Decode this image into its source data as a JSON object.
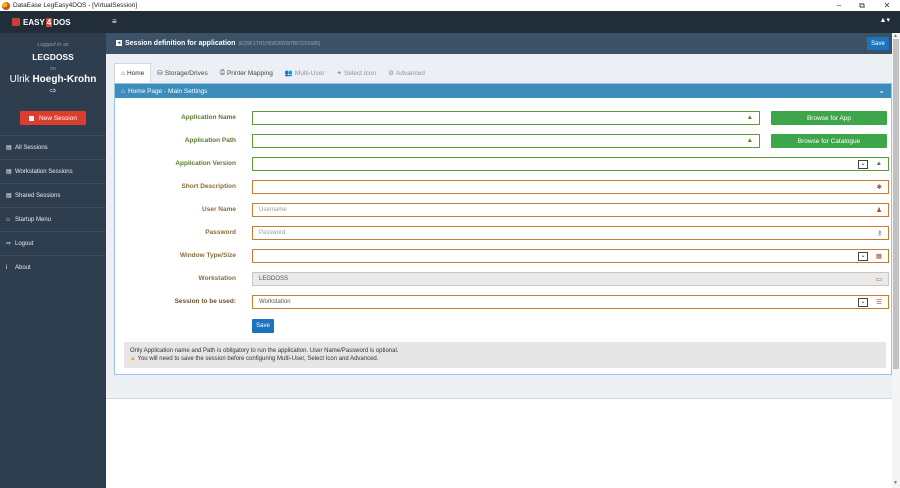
{
  "window": {
    "title": "DataEase LegEasy4DOS - [VirtualSession]",
    "min_glyph": "–",
    "max_glyph": "⧉",
    "close_glyph": "✕"
  },
  "sidebar": {
    "logo_pre": "EASY",
    "logo_four": "4",
    "logo_post": "DOS",
    "logged_in": "Logged in as",
    "workstation": "LEGDOSS",
    "on_label": "on",
    "user_first": "Ulrik ",
    "user_last": "Hoegh-Krohn",
    "logout_glyph": "⇨",
    "new_session": "New Session",
    "items": [
      {
        "icon": "▤",
        "label": "All Sessions"
      },
      {
        "icon": "▤",
        "label": "Workstation Sessions"
      },
      {
        "icon": "▤",
        "label": "Shared Sessions"
      },
      {
        "icon": "⌂",
        "label": "Startup Menu"
      },
      {
        "icon": "⇨",
        "label": "Logout"
      },
      {
        "icon": "i",
        "label": "About"
      }
    ]
  },
  "topbar": {
    "menu_glyph": "≡",
    "user_glyph": "▲▾"
  },
  "header": {
    "title": "Session definition for application",
    "guid": "{ED9F1TH1H5W28DW7BF2201685}",
    "save_label": "Save"
  },
  "tabs": [
    {
      "icon": "⌂",
      "label": "Home"
    },
    {
      "icon": "⛁",
      "label": "Storage/Drives"
    },
    {
      "icon": "⎙",
      "label": "Printer Mapping"
    },
    {
      "icon": "👥",
      "label": "Multi-User"
    },
    {
      "icon": "✦",
      "label": "Select Icon"
    },
    {
      "icon": "⚙",
      "label": "Advanced"
    }
  ],
  "panel": {
    "title_icon": "⌂",
    "title": "Home Page - Main Settings",
    "chevron": "⌄"
  },
  "form": {
    "app_name_label": "Application Name",
    "app_path_label": "Application Path",
    "app_version_label": "Application Version",
    "short_desc_label": "Short Description",
    "user_name_label": "User Name",
    "user_name_placeholder": "Username",
    "password_label": "Password",
    "password_placeholder": "Password",
    "window_type_label": "Window Type/Size",
    "workstation_label": "Workstation",
    "workstation_value": "LEGDOSS",
    "session_label": "Session to be used:",
    "session_value": "Workstation",
    "browse_app": "Browse for App",
    "browse_catalogue": "Browse for Catalogue",
    "save_label": "Save",
    "warn_glyph": "▲",
    "required_glyph": "✱",
    "user_glyph": "♟",
    "key_glyph": "⚷",
    "win_glyph": "▦",
    "monitor_glyph": "▭",
    "stack_glyph": "☰",
    "select_glyph": "⌄"
  },
  "notice": {
    "line1": "Only Application name and Path is obligatory to run the application. User Name/Password is optional.",
    "line2": "You will need to save the session before configuring Mutli-User, Select Icon and Advanced."
  },
  "colors": {
    "sidebar_bg": "#2f3e4f",
    "topbar_bg": "#222d3a",
    "panel_header": "#3c8dbc",
    "button_primary": "#1e73be",
    "button_success": "#3da64b",
    "button_danger": "#dc3d2c"
  }
}
